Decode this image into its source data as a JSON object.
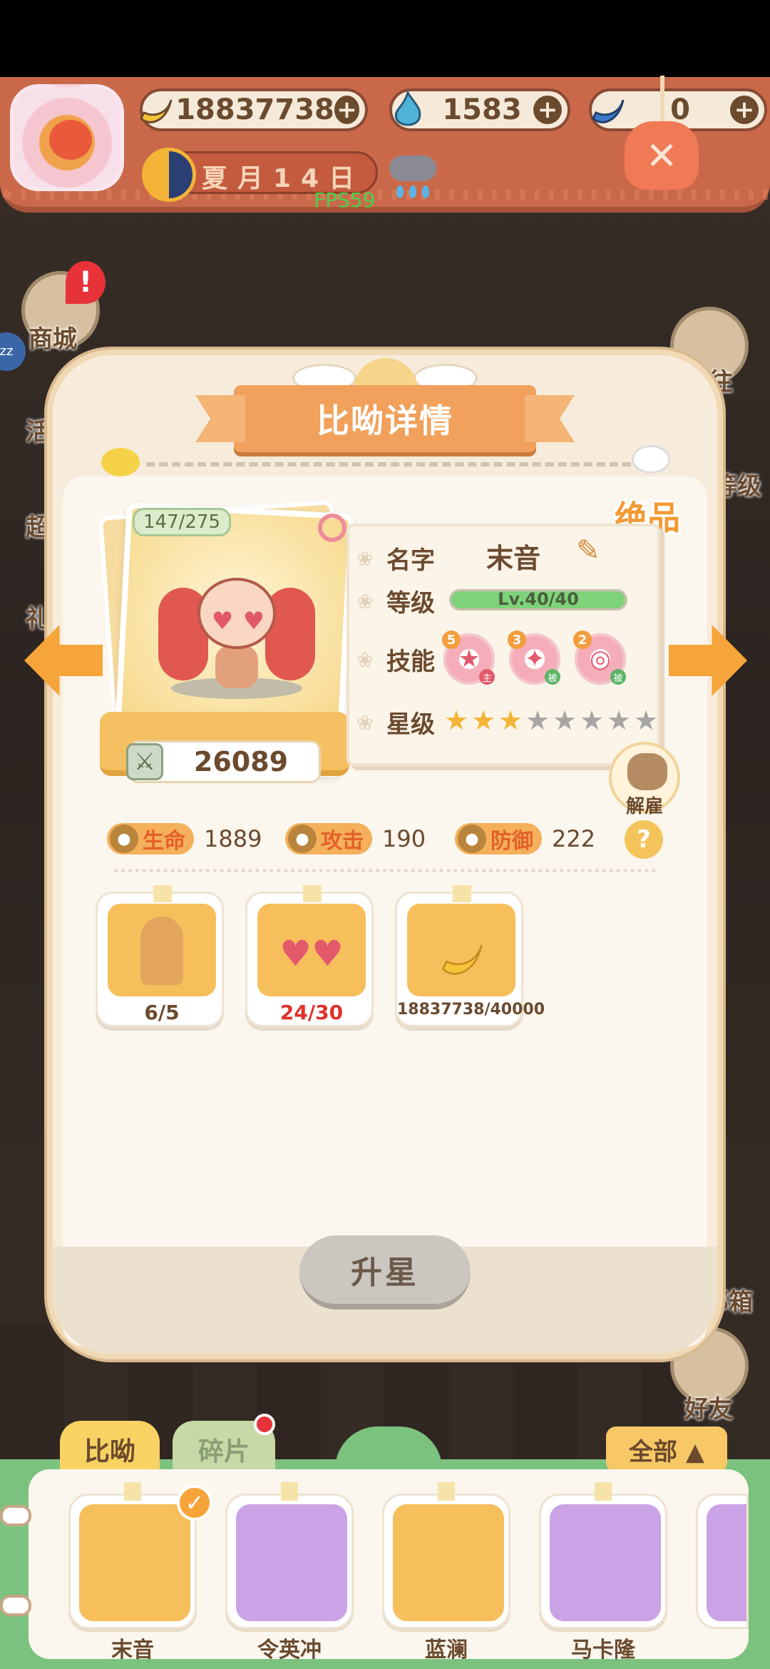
{
  "hud": {
    "currencies": [
      {
        "icon": "banana-icon",
        "value": "18837738",
        "plus": "+"
      },
      {
        "icon": "blue-flame-icon",
        "value": "1583",
        "plus": "+"
      },
      {
        "icon": "blue-banana-icon",
        "value": "0",
        "plus": "+"
      }
    ],
    "date": "夏月14日",
    "fps": "FPS59",
    "close_glyph": "✕"
  },
  "background_buttons": {
    "shop": "商城",
    "goto": "前往",
    "level_fragment": "等级",
    "mailbox_fragment": "邮箱",
    "friends": "好友",
    "left_fragment_1": "活",
    "left_fragment_2": "超",
    "left_fragment_3": "礼",
    "zz": "zz"
  },
  "panel": {
    "title": "比呦详情",
    "tier": "绝品",
    "card": {
      "hp_count": "147/275",
      "power": "26089"
    },
    "info": {
      "name_label": "名字",
      "name_value": "末音",
      "level_label": "等级",
      "level_text": "Lv.40/40",
      "level_progress": 1.0,
      "skills_label": "技能",
      "skills": [
        {
          "level": "5",
          "tag": "主",
          "icon": "star-badge-icon"
        },
        {
          "level": "3",
          "tag": "被",
          "icon": "sword-badge-icon"
        },
        {
          "level": "2",
          "tag": "被",
          "icon": "target-badge-icon"
        }
      ],
      "stars_label": "星级",
      "stars_total": 8,
      "stars_filled": 2.5
    },
    "dismiss_label": "解雇",
    "stats": [
      {
        "label": "生命",
        "value": "1889",
        "icon": "turtle-icon"
      },
      {
        "label": "攻击",
        "value": "190",
        "icon": "bear-icon"
      },
      {
        "label": "防御",
        "value": "222",
        "icon": "cow-icon"
      }
    ],
    "help": "?",
    "materials": [
      {
        "icon": "golden-bust-icon",
        "count": "6/5",
        "insufficient": false
      },
      {
        "icon": "heart-glasses-icon",
        "count": "24/30",
        "insufficient": true
      },
      {
        "icon": "banana-icon",
        "count": "18837738/40000",
        "insufficient": false
      }
    ],
    "upgrade_button": "升星"
  },
  "roster": {
    "tabs": [
      "比呦",
      "碎片"
    ],
    "filter": "全部 ▲",
    "heroes": [
      {
        "name": "末音",
        "selected": true,
        "color": "#f6bf5c"
      },
      {
        "name": "令英冲",
        "selected": false,
        "color": "#c9a3e6"
      },
      {
        "name": "蓝澜",
        "selected": false,
        "color": "#f6bf5c"
      },
      {
        "name": "马卡隆",
        "selected": false,
        "color": "#c9a3e6"
      }
    ]
  }
}
